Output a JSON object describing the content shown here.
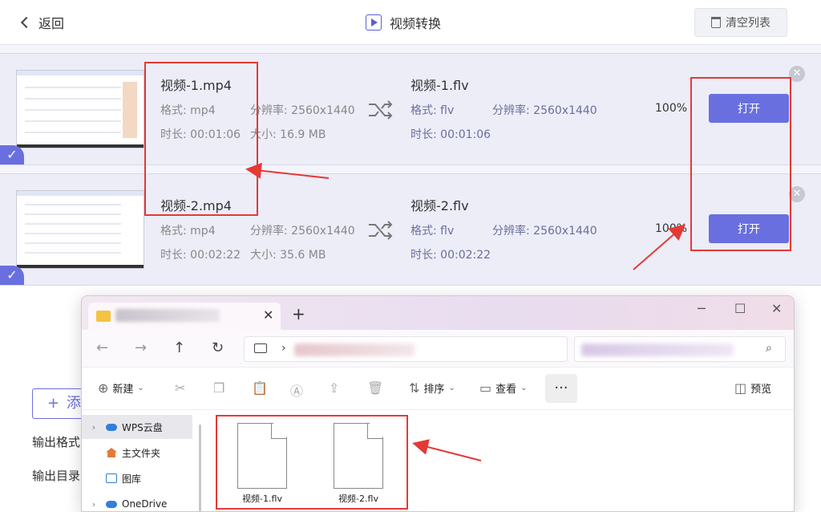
{
  "topbar": {
    "back": "返回",
    "title": "视频转换",
    "clear": "清空列表"
  },
  "rows": [
    {
      "src_name": "视频-1.mp4",
      "src_format": "格式: mp4",
      "src_res": "分辨率: 2560x1440",
      "src_dur": "时长: 00:01:06",
      "src_size": "大小:    16.9 MB",
      "dst_name": "视频-1.flv",
      "dst_format": "格式: flv",
      "dst_res": "分辨率: 2560x1440",
      "dst_dur": "时长: 00:01:06",
      "progress": "100%",
      "open": "打开"
    },
    {
      "src_name": "视频-2.mp4",
      "src_format": "格式: mp4",
      "src_res": "分辨率: 2560x1440",
      "src_dur": "时长: 00:02:22",
      "src_size": "大小:    35.6 MB",
      "dst_name": "视频-2.flv",
      "dst_format": "格式: flv",
      "dst_res": "分辨率: 2560x1440",
      "dst_dur": "时长: 00:02:22",
      "progress": "100%",
      "open": "打开"
    }
  ],
  "bottom": {
    "add": "添",
    "output_format": "输出格式",
    "output_dir": "输出目录"
  },
  "explorer": {
    "toolbar": {
      "new": "新建",
      "sort": "排序",
      "view": "查看",
      "more": "···",
      "preview": "预览"
    },
    "nav": [
      "WPS云盘",
      "主文件夹",
      "图库",
      "OneDrive"
    ],
    "files": [
      "视频-1.flv",
      "视频-2.flv"
    ]
  },
  "colors": {
    "accent": "#6a6fe0",
    "annotation": "#e53935"
  }
}
